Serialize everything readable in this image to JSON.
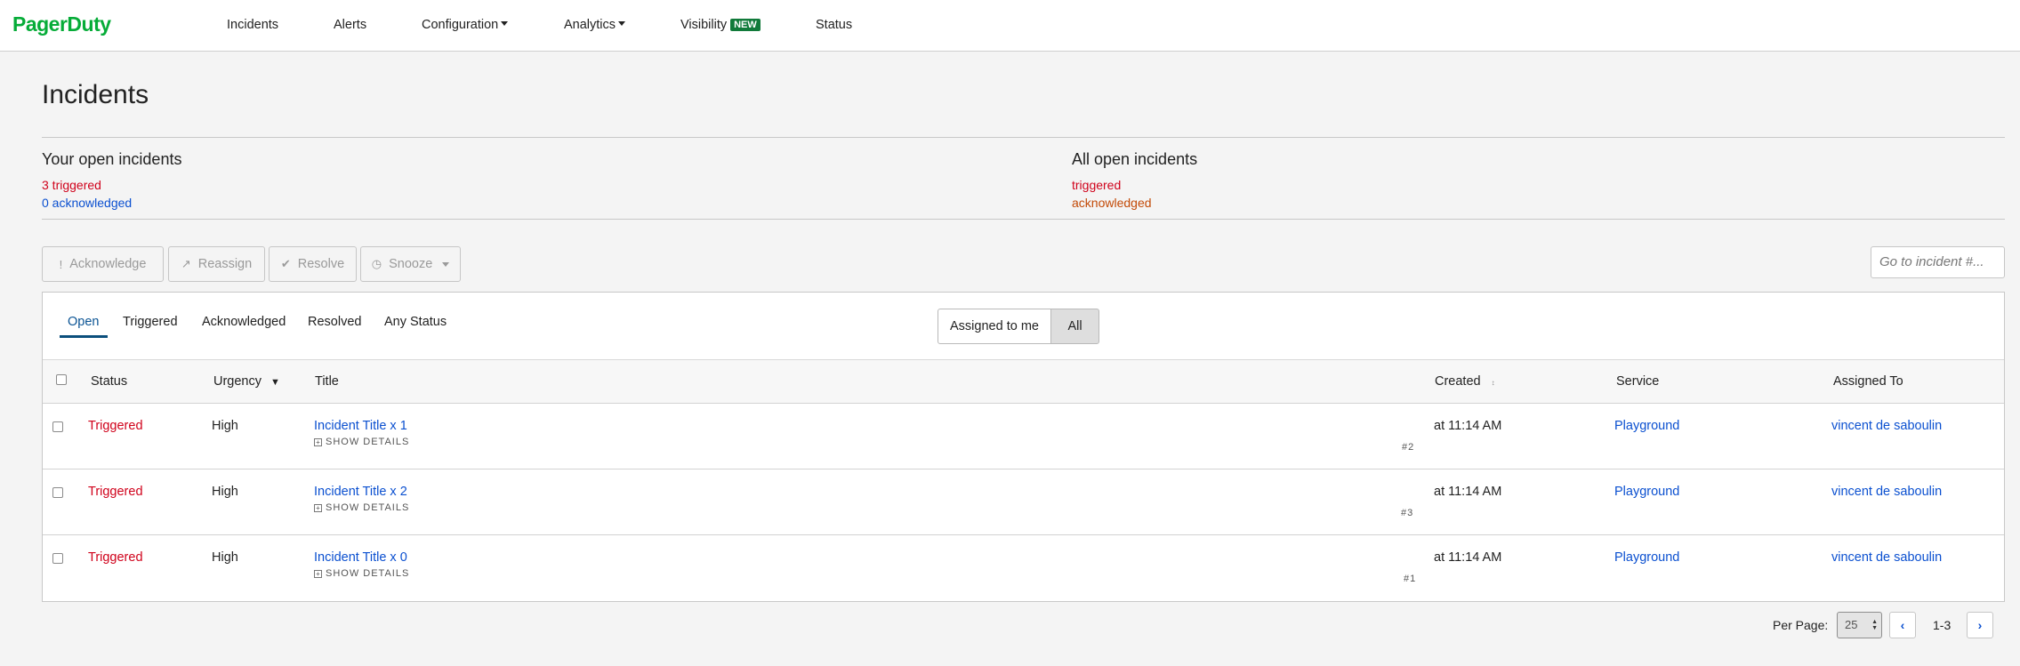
{
  "app": {
    "logo": "PagerDuty"
  },
  "nav": {
    "incidents": "Incidents",
    "alerts": "Alerts",
    "configuration": "Configuration",
    "analytics": "Analytics",
    "visibility": "Visibility",
    "visibility_badge": "NEW",
    "status": "Status"
  },
  "page": {
    "title": "Incidents"
  },
  "summary": {
    "yours_title": "Your open incidents",
    "yours_triggered": "3 triggered",
    "yours_acknowledged": "0 acknowledged",
    "all_title": "All open incidents",
    "all_triggered": "triggered",
    "all_acknowledged": "acknowledged"
  },
  "actions": {
    "acknowledge": "Acknowledge",
    "reassign": "Reassign",
    "resolve": "Resolve",
    "snooze": "Snooze",
    "goto_placeholder": "Go to incident #..."
  },
  "tabs": [
    "Open",
    "Triggered",
    "Acknowledged",
    "Resolved",
    "Any Status"
  ],
  "assign_filter": {
    "mine": "Assigned to me",
    "all": "All"
  },
  "table": {
    "headers": {
      "status": "Status",
      "urgency": "Urgency",
      "title": "Title",
      "created": "Created",
      "service": "Service",
      "assigned": "Assigned To"
    },
    "show_details": "SHOW DETAILS",
    "rows": [
      {
        "status": "Triggered",
        "urgency": "High",
        "title": "Incident Title x 1",
        "number": "#2",
        "created": "at 11:14 AM",
        "service": "Playground",
        "assigned": "vincent de saboulin"
      },
      {
        "status": "Triggered",
        "urgency": "High",
        "title": "Incident Title x 2",
        "number": "#3",
        "created": "at 11:14 AM",
        "service": "Playground",
        "assigned": "vincent de saboulin"
      },
      {
        "status": "Triggered",
        "urgency": "High",
        "title": "Incident Title x 0",
        "number": "#1",
        "created": "at 11:14 AM",
        "service": "Playground",
        "assigned": "vincent de saboulin"
      }
    ]
  },
  "pagination": {
    "per_page_label": "Per Page:",
    "per_page": "25",
    "range": "1-3"
  },
  "colors": {
    "brand": "#06ac38",
    "triggered": "#d0021b",
    "link": "#0b50d0",
    "acknowledged": "#c34a07"
  }
}
